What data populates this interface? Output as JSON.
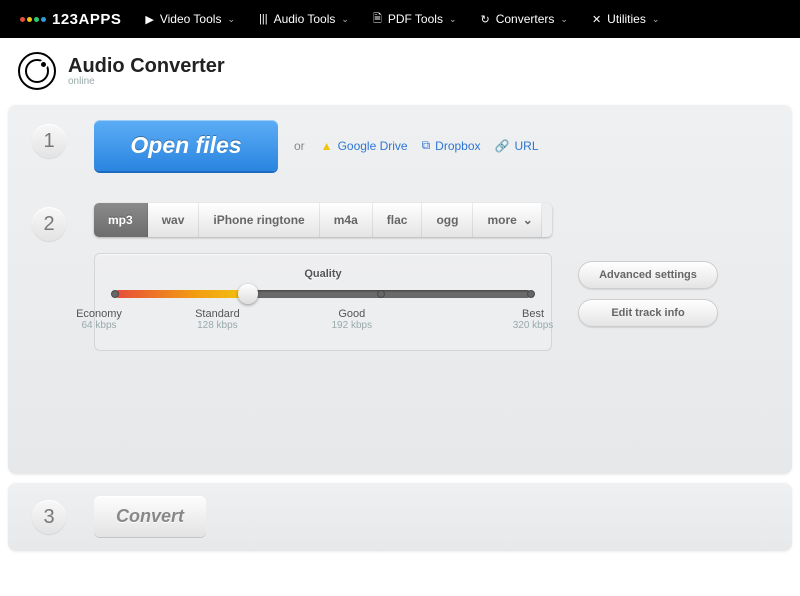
{
  "brand": "123APPS",
  "nav": [
    {
      "label": "Video Tools",
      "icon": "video"
    },
    {
      "label": "Audio Tools",
      "icon": "audio"
    },
    {
      "label": "PDF Tools",
      "icon": "pdf"
    },
    {
      "label": "Converters",
      "icon": "convert"
    },
    {
      "label": "Utilities",
      "icon": "util"
    }
  ],
  "page": {
    "title": "Audio Converter",
    "subtitle": "online"
  },
  "step1": {
    "open": "Open files",
    "or": "or",
    "sources": [
      {
        "label": "Google Drive",
        "icon": "gdrive"
      },
      {
        "label": "Dropbox",
        "icon": "dropbox"
      },
      {
        "label": "URL",
        "icon": "link"
      }
    ]
  },
  "step2": {
    "formats": [
      "mp3",
      "wav",
      "iPhone ringtone",
      "m4a",
      "flac",
      "ogg",
      "more"
    ],
    "selected": "mp3",
    "quality": {
      "title": "Quality",
      "levels": [
        {
          "name": "Economy",
          "rate": "64 kbps",
          "pos": 0
        },
        {
          "name": "Standard",
          "rate": "128 kbps",
          "pos": 32
        },
        {
          "name": "Good",
          "rate": "192 kbps",
          "pos": 64
        },
        {
          "name": "Best",
          "rate": "320 kbps",
          "pos": 100
        }
      ],
      "current": 32
    },
    "advanced": "Advanced settings",
    "editTrack": "Edit track info"
  },
  "step3": {
    "convert": "Convert"
  },
  "colors": {
    "dots": [
      "#e74c3c",
      "#f1c40f",
      "#2ecc71",
      "#3498db"
    ]
  }
}
